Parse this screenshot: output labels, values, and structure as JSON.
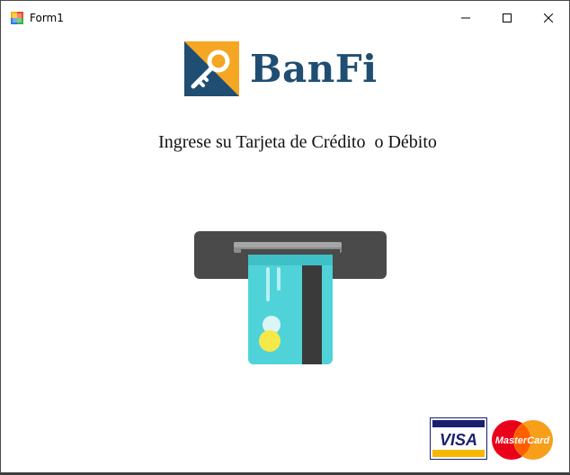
{
  "window": {
    "title": "Form1",
    "controls": {
      "minimize": "minimize-icon",
      "maximize": "maximize-icon",
      "close": "close-icon"
    }
  },
  "brand": {
    "name": "BanFi",
    "logo_icon": "key-icon",
    "colors": {
      "navy": "#1f4e72",
      "orange": "#f5a623"
    }
  },
  "prompt": "Ingrese su Tarjeta de Crédito  o Débito",
  "illustration": {
    "icon": "card-insert-icon",
    "card_color": "#4fd3d9",
    "chip_color": "#f5e94a",
    "slot_color": "#4a4a4a"
  },
  "payment_logos": {
    "visa": "VISA",
    "mastercard": "MasterCard"
  }
}
